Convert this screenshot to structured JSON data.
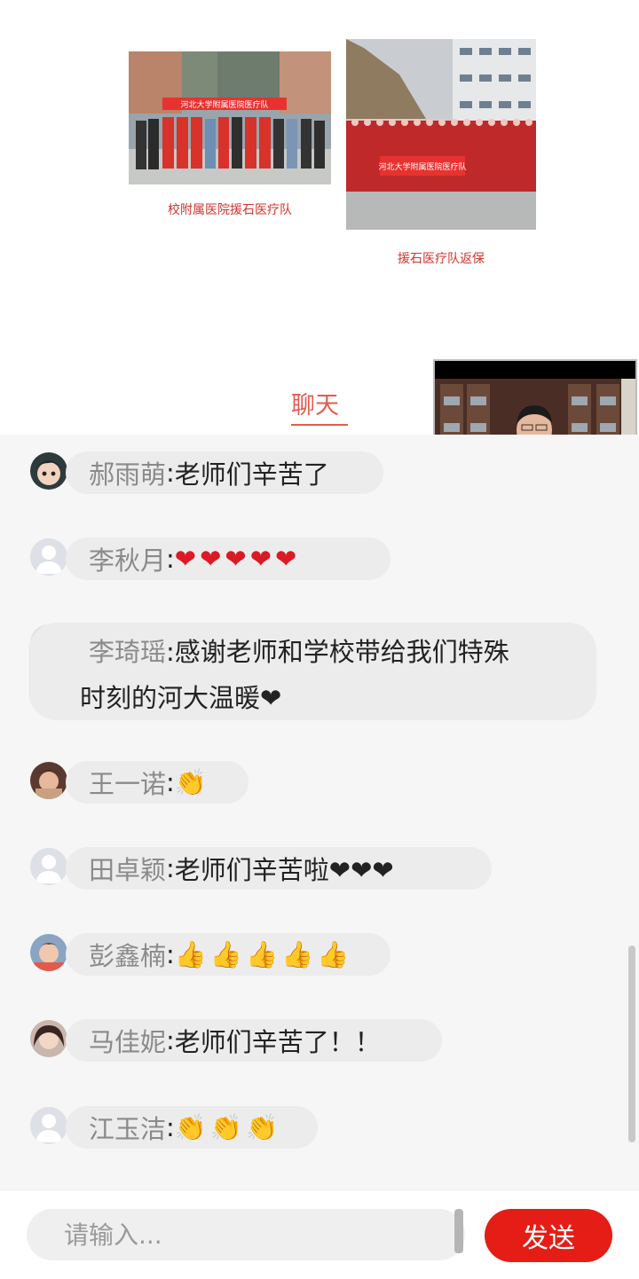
{
  "article": {
    "caption_1": "校附属医院援石医疗队",
    "caption_2": "援石医疗队返保",
    "banner_1": "河北大学附属医院医疗队",
    "banner_2": "河北大学附属医院医疗队"
  },
  "chat": {
    "tab_label": "聊天",
    "messages": [
      {
        "user": "郝雨萌",
        "colon": ":",
        "text": "老师们辛苦了",
        "avatar": "photo"
      },
      {
        "user": "李秋月",
        "colon": ":",
        "text": "❤❤❤❤❤",
        "avatar": "default"
      },
      {
        "user": "李琦瑶",
        "colon": ":",
        "text": "感谢老师和学校带给我们特殊",
        "text_line2": "时刻的河大温暖❤",
        "avatar": "default"
      },
      {
        "user": "王一诺",
        "colon": ":",
        "text": "👏",
        "avatar": "photo"
      },
      {
        "user": "田卓颖",
        "colon": ":",
        "text": "老师们辛苦啦❤❤❤",
        "avatar": "default"
      },
      {
        "user": "彭鑫楠",
        "colon": ":",
        "text": "👍👍👍👍👍",
        "avatar": "photo"
      },
      {
        "user": "马佳妮",
        "colon": ":",
        "text": "老师们辛苦了！！",
        "avatar": "photo"
      },
      {
        "user": "江玉洁",
        "colon": ":",
        "text": "👏👏👏",
        "avatar": "default"
      }
    ]
  },
  "composer": {
    "placeholder": "请输入...",
    "send_label": "发送"
  },
  "colors": {
    "accent": "#e41e16",
    "tab": "#e25c50",
    "heart": "#d91b25"
  }
}
